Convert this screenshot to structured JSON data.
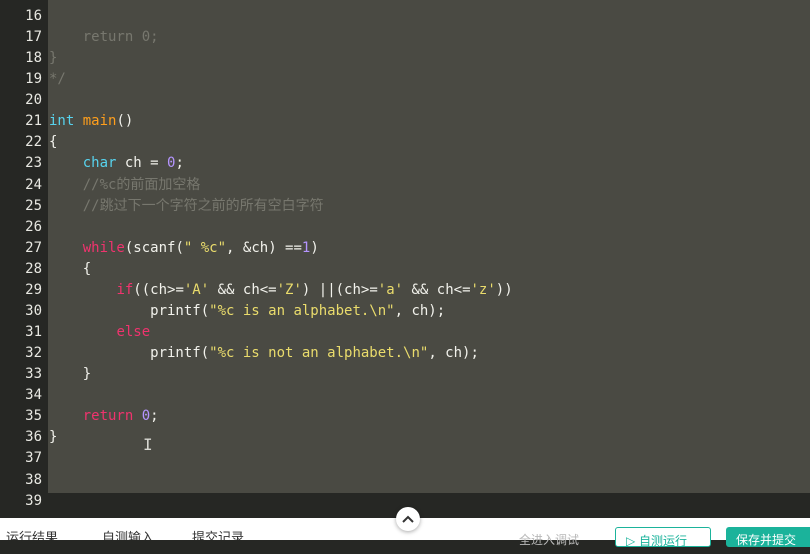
{
  "editor": {
    "lines": [
      {
        "n": "16",
        "tokens": []
      },
      {
        "n": "17",
        "tokens": [
          {
            "t": "    return 0;",
            "c": "cmt"
          }
        ]
      },
      {
        "n": "18",
        "tokens": [
          {
            "t": "}",
            "c": "cmt"
          }
        ]
      },
      {
        "n": "19",
        "tokens": [
          {
            "t": "*/",
            "c": "cmt"
          }
        ]
      },
      {
        "n": "20",
        "tokens": []
      },
      {
        "n": "21",
        "tokens": [
          {
            "t": "int",
            "c": "type"
          },
          {
            "t": " ",
            "c": "plain"
          },
          {
            "t": "main",
            "c": "fn"
          },
          {
            "t": "()",
            "c": "plain"
          }
        ]
      },
      {
        "n": "22",
        "tokens": [
          {
            "t": "{",
            "c": "plain"
          }
        ]
      },
      {
        "n": "23",
        "tokens": [
          {
            "t": "    ",
            "c": "plain"
          },
          {
            "t": "char",
            "c": "type"
          },
          {
            "t": " ch = ",
            "c": "plain"
          },
          {
            "t": "0",
            "c": "num"
          },
          {
            "t": ";",
            "c": "plain"
          }
        ]
      },
      {
        "n": "24",
        "tokens": [
          {
            "t": "    //%c的前面加空格",
            "c": "cmt"
          }
        ]
      },
      {
        "n": "25",
        "tokens": [
          {
            "t": "    //跳过下一个字符之前的所有空白字符",
            "c": "cmt"
          }
        ]
      },
      {
        "n": "26",
        "tokens": []
      },
      {
        "n": "27",
        "tokens": [
          {
            "t": "    ",
            "c": "plain"
          },
          {
            "t": "while",
            "c": "kw"
          },
          {
            "t": "(scanf(",
            "c": "plain"
          },
          {
            "t": "\" %c\"",
            "c": "str"
          },
          {
            "t": ", &ch) ==",
            "c": "plain"
          },
          {
            "t": "1",
            "c": "num"
          },
          {
            "t": ")",
            "c": "plain"
          }
        ]
      },
      {
        "n": "28",
        "tokens": [
          {
            "t": "    {",
            "c": "plain"
          }
        ]
      },
      {
        "n": "29",
        "tokens": [
          {
            "t": "        ",
            "c": "plain"
          },
          {
            "t": "if",
            "c": "kw"
          },
          {
            "t": "((ch>=",
            "c": "plain"
          },
          {
            "t": "'A'",
            "c": "str"
          },
          {
            "t": " && ch<=",
            "c": "plain"
          },
          {
            "t": "'Z'",
            "c": "str"
          },
          {
            "t": ") ||(ch>=",
            "c": "plain"
          },
          {
            "t": "'a'",
            "c": "str"
          },
          {
            "t": " && ch<=",
            "c": "plain"
          },
          {
            "t": "'z'",
            "c": "str"
          },
          {
            "t": "))",
            "c": "plain"
          }
        ]
      },
      {
        "n": "30",
        "tokens": [
          {
            "t": "            printf(",
            "c": "plain"
          },
          {
            "t": "\"%c is an alphabet.\\n\"",
            "c": "str"
          },
          {
            "t": ", ch);",
            "c": "plain"
          }
        ]
      },
      {
        "n": "31",
        "tokens": [
          {
            "t": "        ",
            "c": "plain"
          },
          {
            "t": "else",
            "c": "kw"
          }
        ]
      },
      {
        "n": "32",
        "tokens": [
          {
            "t": "            printf(",
            "c": "plain"
          },
          {
            "t": "\"%c is not an alphabet.\\n\"",
            "c": "str"
          },
          {
            "t": ", ch);",
            "c": "plain"
          }
        ]
      },
      {
        "n": "33",
        "tokens": [
          {
            "t": "    }",
            "c": "plain"
          }
        ]
      },
      {
        "n": "34",
        "tokens": []
      },
      {
        "n": "35",
        "tokens": [
          {
            "t": "    ",
            "c": "plain"
          },
          {
            "t": "return",
            "c": "kw"
          },
          {
            "t": " ",
            "c": "plain"
          },
          {
            "t": "0",
            "c": "num"
          },
          {
            "t": ";",
            "c": "plain"
          }
        ]
      },
      {
        "n": "36",
        "tokens": [
          {
            "t": "}",
            "c": "plain"
          }
        ]
      },
      {
        "n": "37",
        "tokens": []
      },
      {
        "n": "38",
        "tokens": []
      },
      {
        "n": "39",
        "tokens": []
      }
    ]
  },
  "bottom": {
    "tab_result": "运行结果",
    "tab_custom_input": "自测输入",
    "tab_submissions": "提交记录",
    "debug_link": "全进入调试",
    "run_button": "▷ 自测运行",
    "save_submit_button": "保存并提交"
  },
  "colors": {
    "keyword": "#f0336e",
    "type": "#57d3ee",
    "function": "#ff9f1c",
    "number": "#b595ff",
    "string": "#eadc6c",
    "comment": "#77776e",
    "accent": "#1bb39b"
  },
  "icons": {
    "collapse": "chevron-up-icon",
    "text_cursor": "ibeam-cursor-icon"
  }
}
